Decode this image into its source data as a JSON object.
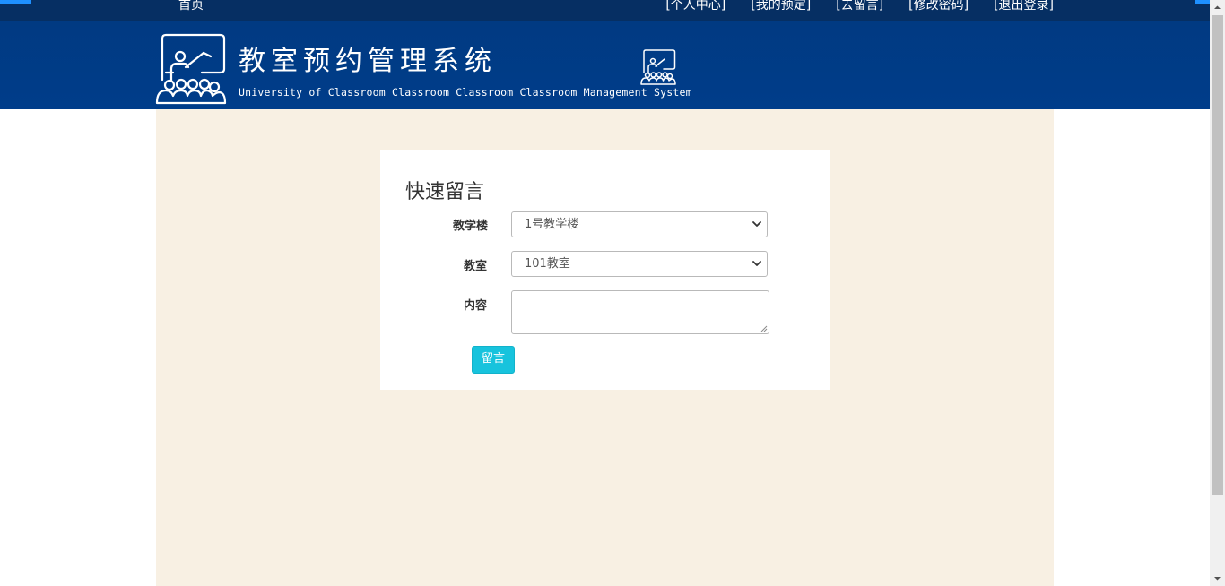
{
  "nav": {
    "home": "首页",
    "links": [
      "[个人中心]",
      "[我的预定]",
      "[去留言]",
      "[修改密码]",
      "[退出登录]"
    ]
  },
  "header": {
    "title": "教室预约管理系统",
    "subtitle": "University of Classroom Classroom Classroom Classroom Management System"
  },
  "form": {
    "title": "快速留言",
    "building_label": "教学楼",
    "building_value": "1号教学楼",
    "room_label": "教室",
    "room_value": "101教室",
    "content_label": "内容",
    "content_value": "",
    "submit_label": "留言"
  },
  "colors": {
    "topbar": "#062f63",
    "header": "#003b86",
    "accent": "#1e90ff",
    "content_bg": "#f8f0e3",
    "button": "#17c3dd"
  },
  "icons": [
    "classroom-logo-icon",
    "classroom-small-icon",
    "chevron-down-icon",
    "resize-grip-icon"
  ]
}
